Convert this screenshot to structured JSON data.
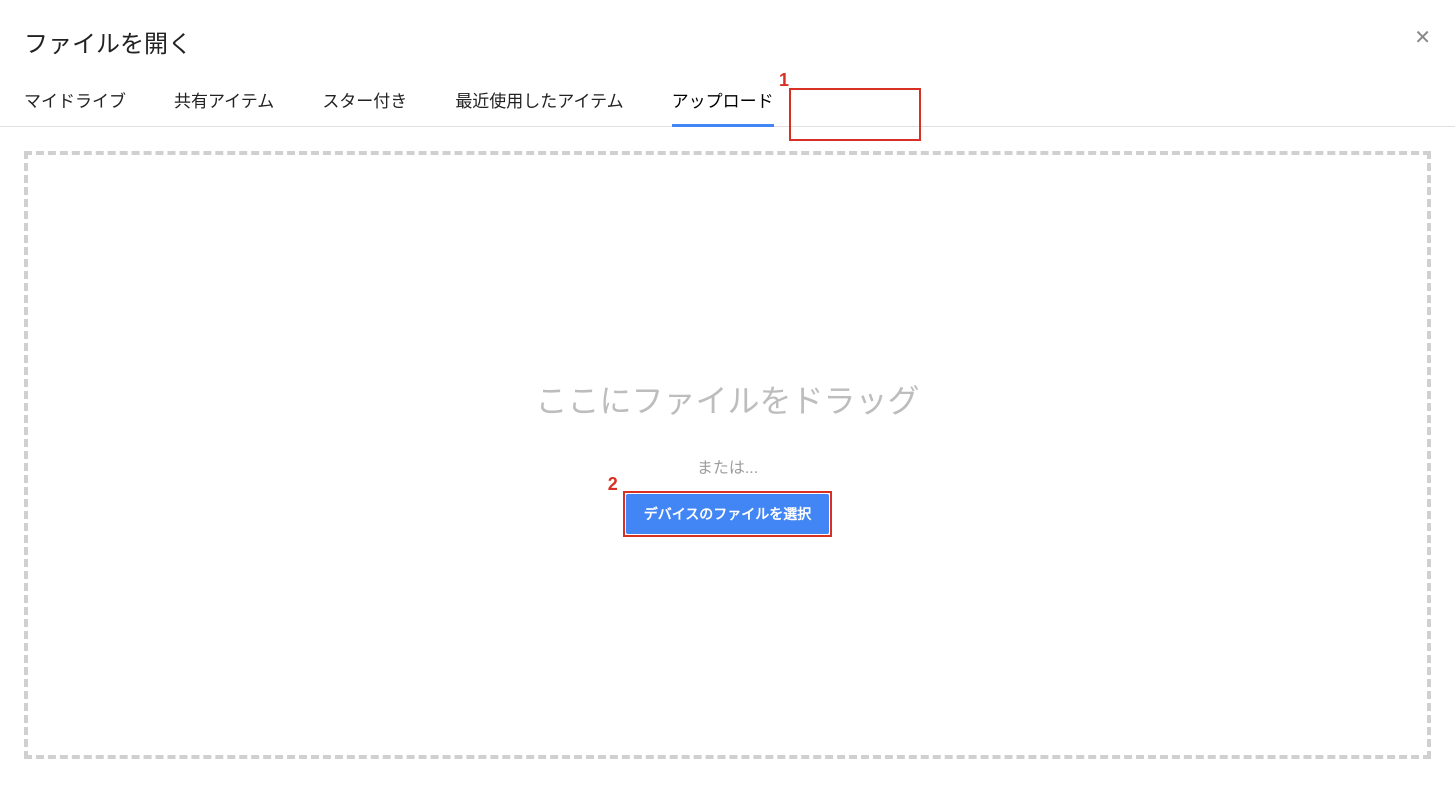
{
  "dialog": {
    "title": "ファイルを開く"
  },
  "tabs": {
    "my_drive": "マイドライブ",
    "shared": "共有アイテム",
    "starred": "スター付き",
    "recent": "最近使用したアイテム",
    "upload": "アップロード"
  },
  "drop": {
    "drag_text": "ここにファイルをドラッグ",
    "or_text": "または...",
    "select_button": "デバイスのファイルを選択"
  },
  "annotations": {
    "one": "1",
    "two": "2"
  }
}
